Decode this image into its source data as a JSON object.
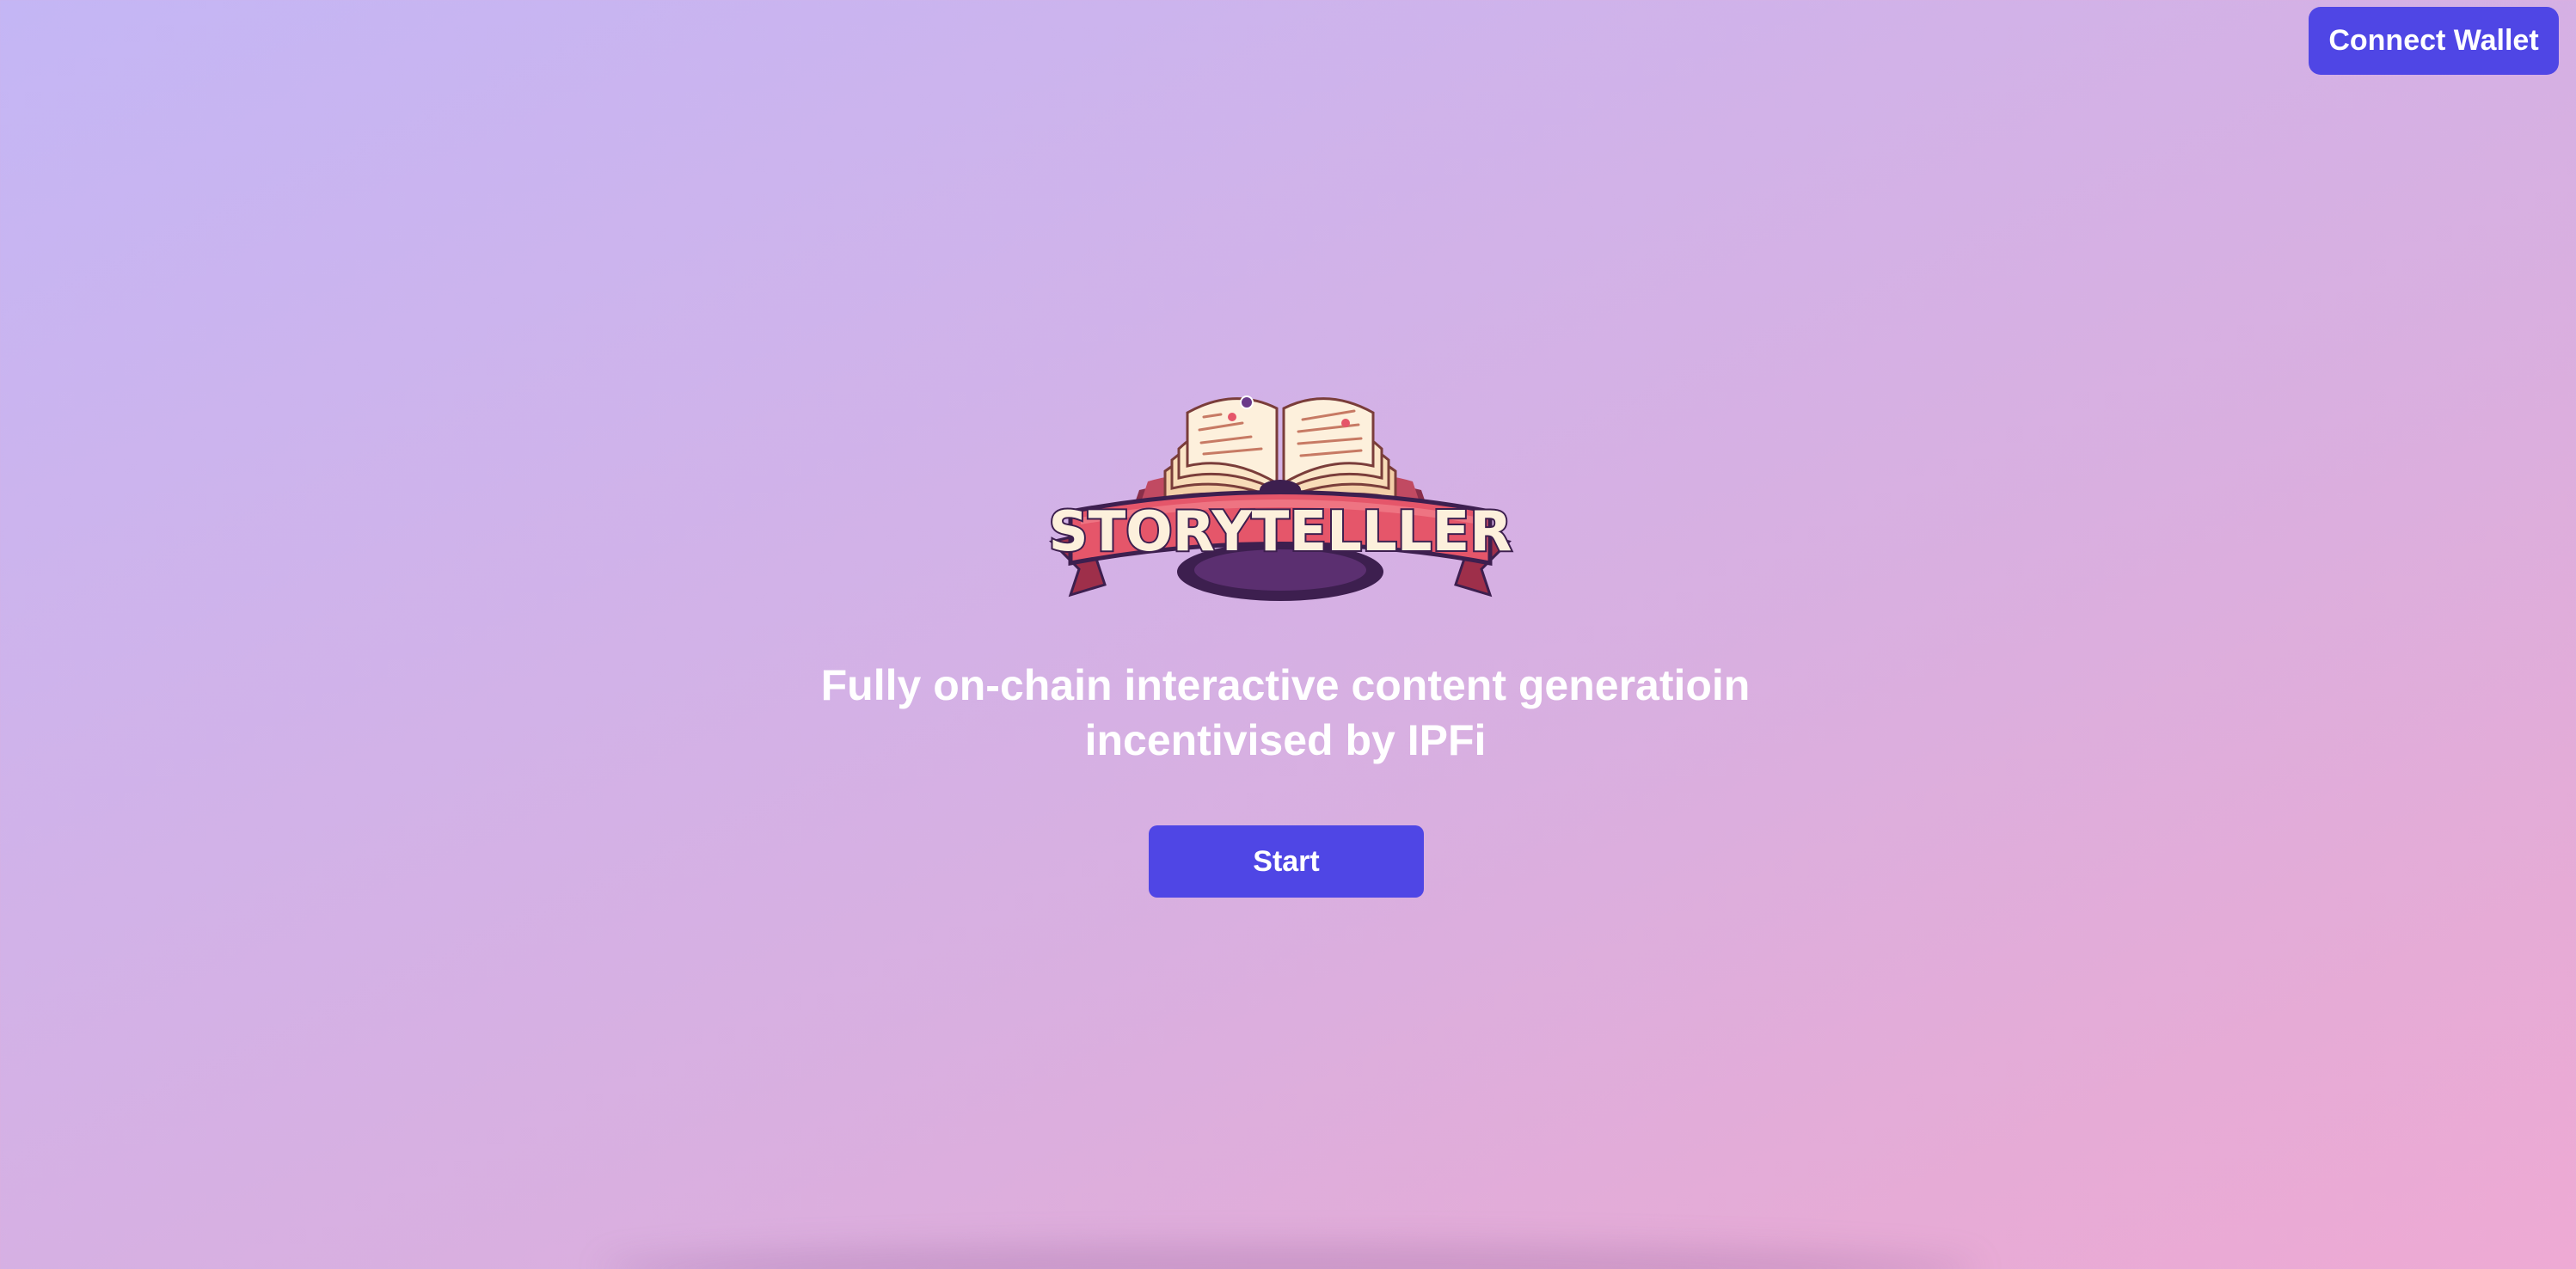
{
  "header": {
    "connect_wallet_label": "Connect Wallet"
  },
  "hero": {
    "logo_text": "STORYTELLLER",
    "tagline_line1": "Fully on-chain interactive content generatioin",
    "tagline_line2": "incentivised by IPFi",
    "start_label": "Start"
  },
  "colors": {
    "accent": "#4f46e5",
    "text": "#ffffff",
    "ribbon": "#e5566a",
    "ribbon_dark": "#9e2f4a",
    "book_page": "#fbe6c8",
    "book_cover": "#b8475d"
  },
  "icons": {
    "logo": "storyteller-book-logo"
  }
}
